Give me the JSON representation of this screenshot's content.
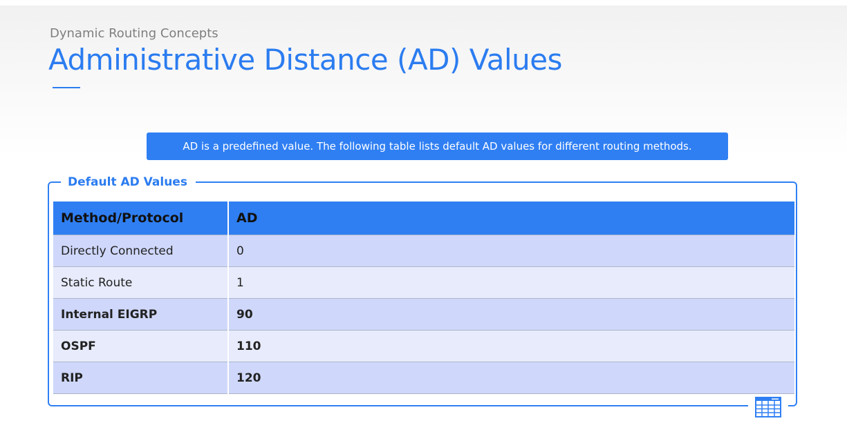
{
  "header": {
    "subtitle": "Dynamic Routing Concepts",
    "title": "Administrative Distance (AD) Values"
  },
  "banner": {
    "text": "AD is a predefined value. The following table lists default AD values for different routing methods."
  },
  "panel": {
    "legend": "Default AD Values",
    "icon": "table-icon"
  },
  "table": {
    "headers": [
      "Method/Protocol",
      "AD"
    ],
    "rows": [
      {
        "method": "Directly Connected",
        "ad": "0"
      },
      {
        "method": "Static Route",
        "ad": "1"
      },
      {
        "method": "Internal EIGRP",
        "ad": "90"
      },
      {
        "method": "OSPF",
        "ad": "110"
      },
      {
        "method": "RIP",
        "ad": "120"
      }
    ]
  },
  "colors": {
    "accent": "#2f7ff3",
    "title": "#2b7cf0",
    "row_odd": "#cfd8fb",
    "row_even": "#e7ebfb"
  }
}
